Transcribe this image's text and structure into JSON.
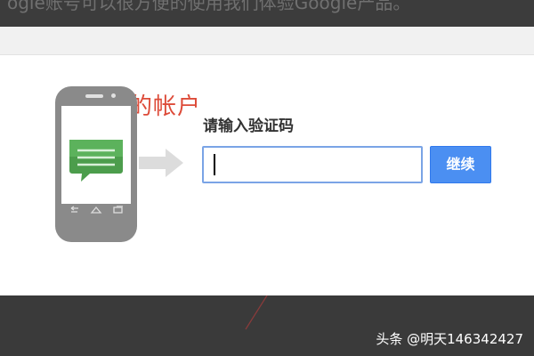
{
  "article": {
    "top_text": "ogle账号可以很方便的使用我们体验Google产品。"
  },
  "verify": {
    "title": "验证您的帐户",
    "prompt": "请输入验证码",
    "code_value": "",
    "continue_label": "继续"
  },
  "icons": {
    "phone": "phone-icon",
    "message": "chat-bubble-icon",
    "arrow": "arrow-right-icon",
    "nav_back": "back-icon",
    "nav_home": "home-icon",
    "nav_recent": "recent-apps-icon"
  },
  "colors": {
    "title": "#dd4b39",
    "button": "#4b8ff2",
    "input_border": "#7aa4e6",
    "message_green": "#4c9d4c"
  },
  "watermark": {
    "text": "头条 @明天146342427"
  }
}
